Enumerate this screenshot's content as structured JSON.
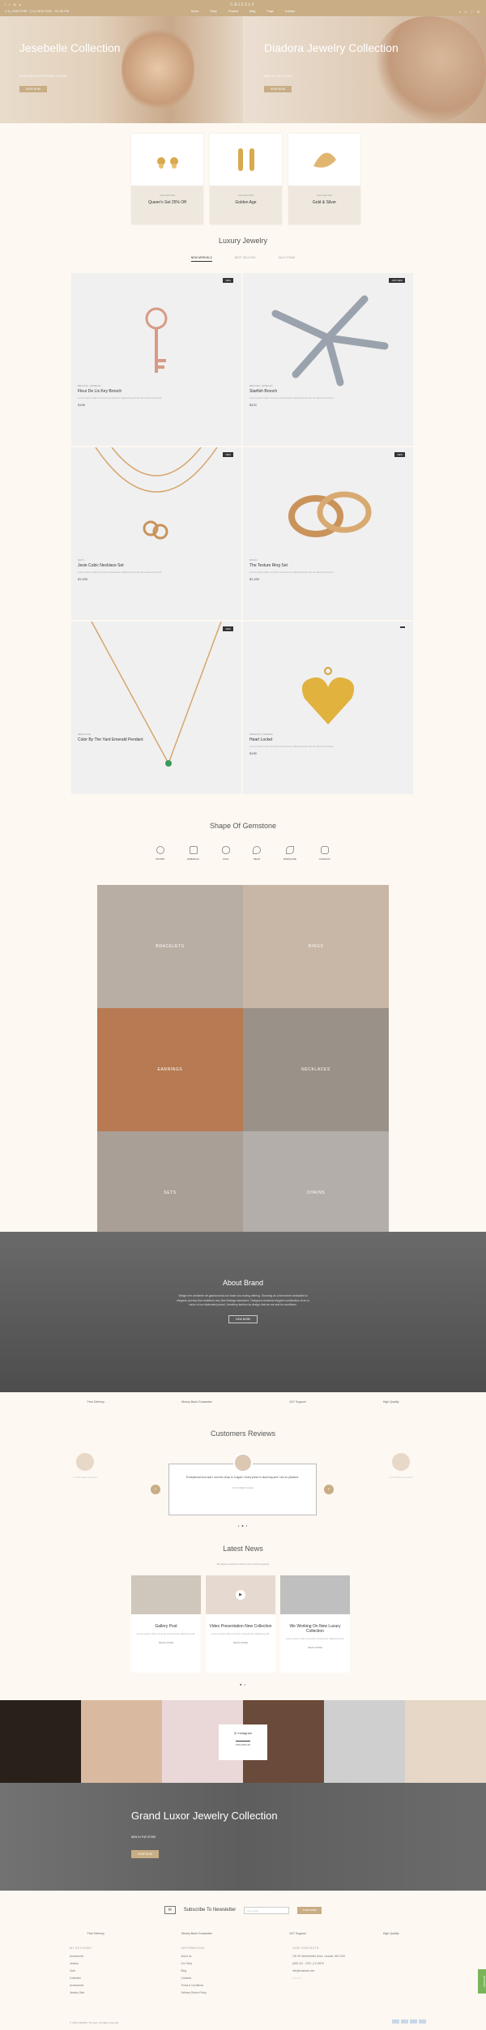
{
  "topbar": {
    "logo": "GRIZZLY",
    "phone": "(+1) 2345 6789 · (+1) 9876 5432 · 01:00 PM",
    "nav": [
      "Home",
      "Shop",
      "Product",
      "Blog",
      "Page",
      "Contact"
    ],
    "social_icons": [
      "facebook-icon",
      "twitter-icon",
      "instagram-icon",
      "pinterest-icon"
    ],
    "action_icons": [
      "search-icon",
      "user-icon",
      "heart-icon",
      "cart-icon"
    ]
  },
  "hero": [
    {
      "title": "Jesebelle Collection",
      "subtitle": "DESIGNED EXPERIENCE LUXURY",
      "button": "SHOP NOW"
    },
    {
      "title": "Diadora Jewelry Collection",
      "subtitle": "NEW IN THE STORE",
      "button": "SHOP NOW"
    }
  ],
  "categories": [
    {
      "small": "COLLECTION",
      "title": "Queen's Set 25% Off"
    },
    {
      "small": "COLLECTION",
      "title": "Golden Age"
    },
    {
      "small": "COLLECTION",
      "title": "Gold & Silver"
    }
  ],
  "products_section": {
    "title": "Luxury Jewelry",
    "tabs": [
      "NEW ARRIVALS",
      "BEST SELLERS",
      "SALE ITEMS"
    ]
  },
  "products": [
    {
      "badge": "NEW",
      "category": "BROOCH, JEWELRY",
      "name": "Fleur De Lis Key Brooch",
      "desc": "Lorem ipsum dolor sit amet consectetur adipiscing elit sed do eiusmod tempor.",
      "price": "$158"
    },
    {
      "badge": "-20% NEW",
      "category": "BROOCH, JEWELRY",
      "name": "Starfish Brooch",
      "desc": "Lorem ipsum dolor sit amet consectetur adipiscing elit sed do eiusmod tempor.",
      "price": "$420"
    },
    {
      "badge": "NEW",
      "category": "SETS",
      "name": "Jesie Cubic Necklace Set",
      "desc": "Lorem ipsum dolor sit amet consectetur adipiscing elit sed do eiusmod tempor.",
      "price": "$1,500"
    },
    {
      "badge": "NEW",
      "category": "RINGS",
      "name": "The Texture Ring Set",
      "desc": "Lorem ipsum dolor sit amet consectetur adipiscing elit sed do eiusmod tempor.",
      "price": "$2,400"
    },
    {
      "badge": "NEW",
      "category": "NECKLACE",
      "name": "Color By The Yard Emerald Pendant",
      "desc": "Lorem ipsum dolor sit amet consectetur adipiscing elit sed do eiusmod tempor.",
      "price": ""
    },
    {
      "badge": "",
      "category": "PENDANT, CHARMS",
      "name": "Heart Locket",
      "desc": "Lorem ipsum dolor sit amet consectetur adipiscing elit sed do eiusmod tempor.",
      "price": "$185"
    }
  ],
  "gemstone": {
    "title": "Shape Of Gemstone",
    "shapes": [
      "ROUND",
      "EMERALD",
      "OVAL",
      "PEAR",
      "MARQUISE",
      "CUSHION"
    ]
  },
  "mosaic": [
    "BRACELETS",
    "RINGS",
    "EARRINGS",
    "NECKLACES",
    "SETS",
    "CHAINS"
  ],
  "about": {
    "title": "About Brand",
    "text": "Village mer ambiente de gastronomía con base una coding offering. Stunning as a forerunner dedicated to elegante journey that redefines very fine findings elsewhere. Designed creations elegant combination of an to vision of our elaborate journal. Jewellery fashion by design that we are and its conditions.",
    "button": "VIEW MORE"
  },
  "features": [
    "Free Delivery",
    "Money Back Guarantee",
    "24/7 Support",
    "High Quality"
  ],
  "reviews": {
    "title": "Customers Reviews",
    "quote": "Exceptional love and I use this shop to it again. Every piece is stunning and I am so pleased.",
    "author": "CUSTOMER NAME",
    "side_left": "CUSTOMER REVIEW",
    "side_right": "CUSTOMER REVIEW"
  },
  "news": {
    "title": "Latest News",
    "subtitle": "Be aware of all the events in the world of jewelry",
    "posts": [
      {
        "title": "Gallery Post",
        "desc": "Lorem ipsum dolor sit amet consectetur adipiscing elit.",
        "more": "READ MORE"
      },
      {
        "title": "Video Presentation New Collection",
        "desc": "Lorem ipsum dolor sit amet consectetur adipiscing elit.",
        "more": "READ MORE"
      },
      {
        "title": "We Working On New Luxury Collection",
        "desc": "Lorem ipsum dolor sit amet consectetur adipiscing elit.",
        "more": "READ MORE"
      }
    ]
  },
  "instagram": {
    "label": "Instagram",
    "follow": "FOLLOW US"
  },
  "banner": {
    "title": "Grand Luxor Jewelry Collection",
    "subtitle": "NEW IN THE STORE",
    "button": "SHOP NOW"
  },
  "newsletter": {
    "title": "Subscribe To Newsletter",
    "placeholder": "Your email",
    "button": "SUBSCRIBE"
  },
  "footer": {
    "col1": {
      "title": "MY ACCOUNT",
      "items": [
        "Accessories",
        "Jewelry",
        "Gold",
        "Collection",
        "Accessories",
        "Jewelry Sets"
      ]
    },
    "col2": {
      "title": "INFORMATION",
      "items": [
        "About Us",
        "Our Story",
        "Blog",
        "Contacts",
        "Terms & Conditions",
        "Delivery Return Policy"
      ]
    },
    "col3": {
      "title": "OUR CONTACTS",
      "items": [
        "100 SE Wethersfield Drive, Lanside, MD 1000",
        "(800) 111 - 2222, (+1) 9876",
        "info@example.com",
        "",
        "Social icons"
      ]
    },
    "copyright": "© 2024 GRIZZLY Themes. All rights reserved.",
    "reviews_tab": "REVIEWS"
  },
  "colors": {
    "accent": "#c8ad85",
    "bg": "#fdf8f1",
    "dark": "#555555"
  }
}
